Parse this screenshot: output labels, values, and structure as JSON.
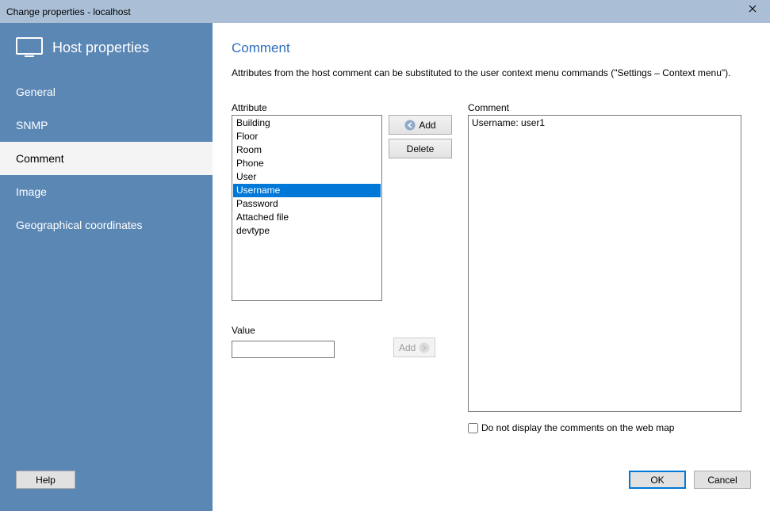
{
  "window": {
    "title": "Change properties - localhost"
  },
  "sidebar": {
    "title": "Host properties",
    "items": [
      {
        "label": "General",
        "key": "general",
        "active": false
      },
      {
        "label": "SNMP",
        "key": "snmp",
        "active": false
      },
      {
        "label": "Comment",
        "key": "comment",
        "active": true
      },
      {
        "label": "Image",
        "key": "image",
        "active": false
      },
      {
        "label": "Geographical coordinates",
        "key": "geo",
        "active": false
      }
    ],
    "help_label": "Help"
  },
  "page": {
    "title": "Comment",
    "description": "Attributes from the host comment can be substituted to the user context menu commands (\"Settings – Context menu\")."
  },
  "attribute": {
    "label": "Attribute",
    "items": [
      {
        "label": "Building",
        "selected": false
      },
      {
        "label": "Floor",
        "selected": false
      },
      {
        "label": "Room",
        "selected": false
      },
      {
        "label": "Phone",
        "selected": false
      },
      {
        "label": "User",
        "selected": false
      },
      {
        "label": "Username",
        "selected": true
      },
      {
        "label": "Password",
        "selected": false
      },
      {
        "label": "Attached file",
        "selected": false
      },
      {
        "label": "devtype",
        "selected": false
      }
    ]
  },
  "buttons": {
    "add": "Add",
    "delete": "Delete",
    "add_value": "Add",
    "ok": "OK",
    "cancel": "Cancel"
  },
  "value": {
    "label": "Value",
    "value": ""
  },
  "comment": {
    "label": "Comment",
    "text": "Username: user1"
  },
  "checkbox": {
    "label": "Do not display the comments on the web map",
    "checked": false
  }
}
